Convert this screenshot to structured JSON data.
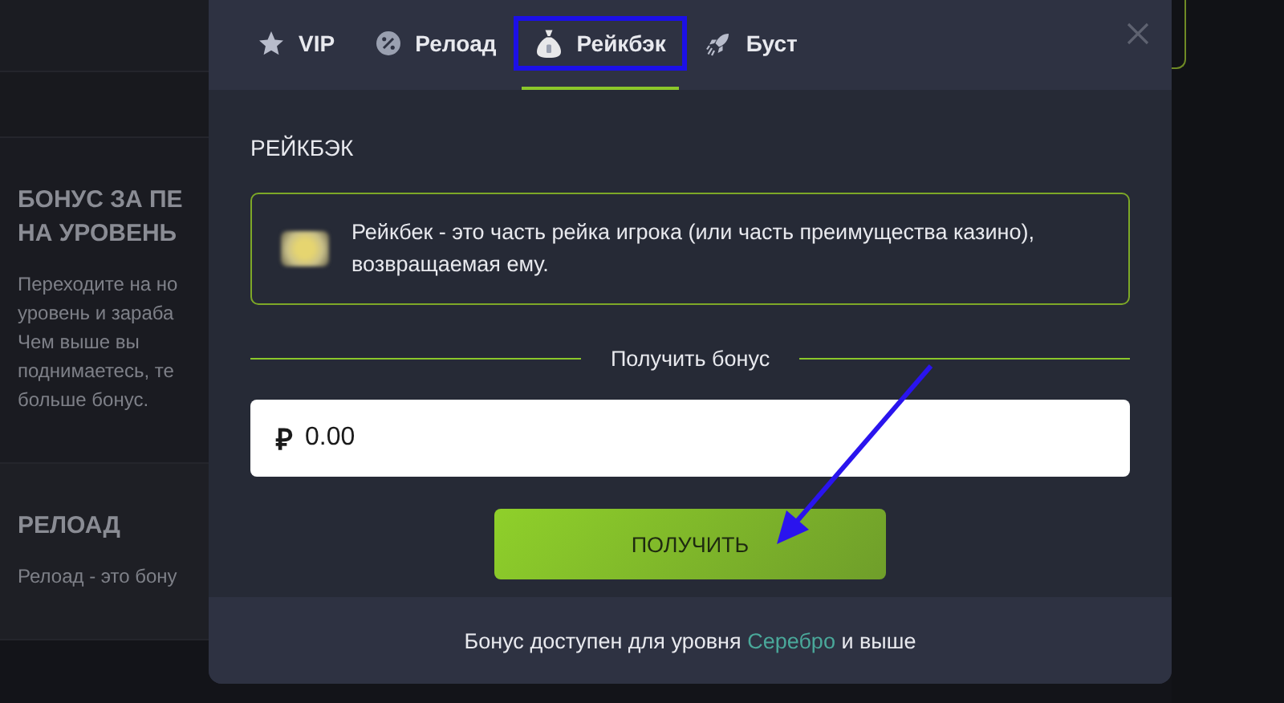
{
  "background": {
    "sections": [
      {
        "title_lines": [
          "БОНУС ЗА ПЕ",
          "НА УРОВЕНЬ"
        ],
        "text_lines": [
          "Переходите на но",
          "уровень и зараба",
          "Чем выше вы",
          "поднимаетесь, те",
          "больше бонус."
        ]
      },
      {
        "title_lines": [
          "РЕЛОАД"
        ],
        "text_lines": [
          "Релоад - это бону"
        ]
      }
    ]
  },
  "modal": {
    "tabs": [
      {
        "label": "VIP",
        "selected": false,
        "highlighted": false
      },
      {
        "label": "Релоад",
        "selected": false,
        "highlighted": false
      },
      {
        "label": "Рейкбэк",
        "selected": true,
        "highlighted": true
      },
      {
        "label": "Буст",
        "selected": false,
        "highlighted": false
      }
    ],
    "heading": "РЕЙКБЭК",
    "info": "Рейкбек - это часть рейка игрока (или часть преимущества казино), возвращаемая ему.",
    "divider_label": "Получить бонус",
    "amount": {
      "currency": "₽",
      "value": "0.00"
    },
    "button": "ПОЛУЧИТЬ",
    "footer": {
      "before": "Бонус доступен для уровня",
      "link": "Серебро",
      "after": "и выше"
    }
  }
}
